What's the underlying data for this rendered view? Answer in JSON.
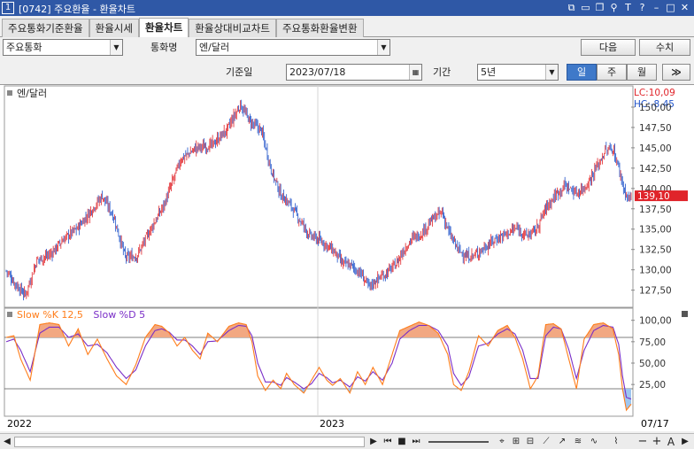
{
  "window": {
    "number": "1",
    "title": "[0742] 주요환율 - 환율차트",
    "icons": [
      "layout-icon",
      "dock-icon",
      "window-icon",
      "pin-icon",
      "font-icon",
      "help-icon",
      "minimize-icon",
      "maximize-icon",
      "close-icon"
    ]
  },
  "tabs": [
    "주요통화기준환율",
    "환율시세",
    "환율차트",
    "환율상대비교차트",
    "주요통화환율변환"
  ],
  "active_tab": 2,
  "filters": {
    "category_value": "주요통화",
    "currency_label": "통화명",
    "currency_value": "엔/달러",
    "next_label": "다음",
    "query_label": "수치",
    "base_date_label": "기준일",
    "base_date_value": "2023/07/18",
    "period_label": "기간",
    "period_value": "5년",
    "intervals": [
      "일",
      "주",
      "월"
    ],
    "active_interval": 0,
    "expand_label": "≫"
  },
  "chart_data": [
    {
      "type": "candlestick",
      "title": "엔/달러",
      "lc_label": "LC:10,09",
      "hc_label": "HC:-8,45",
      "current_value_label": "139,10",
      "ylim": [
        125.5,
        152.5
      ],
      "y_ticks": [
        "150,00",
        "147,50",
        "145,00",
        "142,50",
        "140,00",
        "137,50",
        "135,00",
        "132,50",
        "130,00",
        "127,50"
      ],
      "y_tick_values": [
        150,
        147.5,
        145,
        142.5,
        140,
        137.5,
        135,
        132.5,
        130,
        127.5
      ],
      "colors": {
        "up": "#e0242a",
        "down": "#1f52c9",
        "current_bg": "#e0242a"
      },
      "anchors_index_close": [
        [
          0,
          129.9
        ],
        [
          10,
          128.2
        ],
        [
          20,
          126.9
        ],
        [
          32,
          131.2
        ],
        [
          46,
          131.9
        ],
        [
          60,
          133.8
        ],
        [
          74,
          135.1
        ],
        [
          84,
          136.6
        ],
        [
          100,
          139.1
        ],
        [
          112,
          136.5
        ],
        [
          124,
          131.5
        ],
        [
          136,
          131.7
        ],
        [
          150,
          134.9
        ],
        [
          164,
          137.9
        ],
        [
          182,
          143.6
        ],
        [
          198,
          145.0
        ],
        [
          214,
          145.3
        ],
        [
          230,
          147.2
        ],
        [
          244,
          150.3
        ],
        [
          254,
          148.2
        ],
        [
          266,
          147.1
        ],
        [
          276,
          142.3
        ],
        [
          286,
          139.2
        ],
        [
          296,
          138.0
        ],
        [
          306,
          136.1
        ],
        [
          316,
          134.2
        ],
        [
          330,
          133.4
        ],
        [
          342,
          132.2
        ],
        [
          350,
          130.8
        ],
        [
          360,
          130.5
        ],
        [
          370,
          129.4
        ],
        [
          378,
          127.9
        ],
        [
          386,
          128.8
        ],
        [
          396,
          129.6
        ],
        [
          406,
          130.7
        ],
        [
          414,
          132.4
        ],
        [
          422,
          133.8
        ],
        [
          432,
          134.4
        ],
        [
          444,
          136.2
        ],
        [
          454,
          137.1
        ],
        [
          462,
          134.3
        ],
        [
          472,
          132.3
        ],
        [
          480,
          131.6
        ],
        [
          488,
          131.8
        ],
        [
          500,
          132.9
        ],
        [
          510,
          133.8
        ],
        [
          520,
          134.4
        ],
        [
          532,
          135.1
        ],
        [
          542,
          134.2
        ],
        [
          552,
          134.9
        ],
        [
          562,
          137.6
        ],
        [
          572,
          139.2
        ],
        [
          582,
          140.4
        ],
        [
          594,
          139.4
        ],
        [
          604,
          140.3
        ],
        [
          614,
          142.4
        ],
        [
          624,
          144.6
        ],
        [
          632,
          144.9
        ],
        [
          638,
          142.5
        ],
        [
          644,
          139.7
        ],
        [
          648,
          138.6
        ],
        [
          651,
          139.1
        ]
      ]
    },
    {
      "type": "line",
      "title": "Slow %K 12,5   Slow %D 5",
      "series": [
        {
          "name": "Slow %K 12,5",
          "color": "#ff7d1a"
        },
        {
          "name": "Slow %D 5",
          "color": "#7a2ec7"
        }
      ],
      "ylim": [
        -10,
        110
      ],
      "y_ticks": [
        "100,00",
        "75,00",
        "50,00",
        "25,00"
      ],
      "y_tick_values": [
        100,
        75,
        50,
        25
      ],
      "reference_lines": [
        80,
        20
      ],
      "fill_colors": {
        "over": "#f2a882",
        "under": "#9ec6f0"
      },
      "anchors_index_k": [
        [
          0,
          80
        ],
        [
          8,
          82
        ],
        [
          15,
          55
        ],
        [
          25,
          30
        ],
        [
          35,
          95
        ],
        [
          45,
          97
        ],
        [
          55,
          95
        ],
        [
          65,
          70
        ],
        [
          75,
          90
        ],
        [
          85,
          60
        ],
        [
          95,
          78
        ],
        [
          105,
          55
        ],
        [
          115,
          35
        ],
        [
          125,
          25
        ],
        [
          135,
          48
        ],
        [
          145,
          80
        ],
        [
          155,
          95
        ],
        [
          162,
          93
        ],
        [
          170,
          85
        ],
        [
          178,
          70
        ],
        [
          186,
          80
        ],
        [
          194,
          65
        ],
        [
          202,
          55
        ],
        [
          210,
          85
        ],
        [
          220,
          75
        ],
        [
          232,
          93
        ],
        [
          242,
          97
        ],
        [
          250,
          95
        ],
        [
          256,
          75
        ],
        [
          262,
          35
        ],
        [
          270,
          18
        ],
        [
          278,
          30
        ],
        [
          286,
          20
        ],
        [
          292,
          38
        ],
        [
          300,
          25
        ],
        [
          310,
          15
        ],
        [
          318,
          30
        ],
        [
          326,
          45
        ],
        [
          334,
          30
        ],
        [
          340,
          24
        ],
        [
          348,
          32
        ],
        [
          358,
          15
        ],
        [
          366,
          40
        ],
        [
          374,
          25
        ],
        [
          382,
          45
        ],
        [
          392,
          25
        ],
        [
          402,
          60
        ],
        [
          410,
          88
        ],
        [
          420,
          93
        ],
        [
          430,
          98
        ],
        [
          440,
          94
        ],
        [
          450,
          85
        ],
        [
          460,
          60
        ],
        [
          466,
          25
        ],
        [
          474,
          18
        ],
        [
          482,
          40
        ],
        [
          492,
          82
        ],
        [
          502,
          70
        ],
        [
          512,
          88
        ],
        [
          522,
          94
        ],
        [
          530,
          80
        ],
        [
          538,
          55
        ],
        [
          546,
          20
        ],
        [
          554,
          35
        ],
        [
          562,
          95
        ],
        [
          570,
          96
        ],
        [
          578,
          90
        ],
        [
          586,
          55
        ],
        [
          594,
          20
        ],
        [
          602,
          78
        ],
        [
          612,
          95
        ],
        [
          622,
          97
        ],
        [
          632,
          90
        ],
        [
          638,
          60
        ],
        [
          642,
          20
        ],
        [
          646,
          -5
        ],
        [
          651,
          2
        ]
      ],
      "anchors_index_d": [
        [
          0,
          75
        ],
        [
          8,
          78
        ],
        [
          15,
          65
        ],
        [
          25,
          40
        ],
        [
          35,
          85
        ],
        [
          45,
          92
        ],
        [
          55,
          92
        ],
        [
          65,
          80
        ],
        [
          75,
          84
        ],
        [
          85,
          70
        ],
        [
          95,
          72
        ],
        [
          105,
          62
        ],
        [
          115,
          45
        ],
        [
          125,
          32
        ],
        [
          135,
          42
        ],
        [
          145,
          70
        ],
        [
          155,
          88
        ],
        [
          162,
          90
        ],
        [
          170,
          86
        ],
        [
          178,
          77
        ],
        [
          186,
          77
        ],
        [
          194,
          70
        ],
        [
          202,
          60
        ],
        [
          210,
          75
        ],
        [
          220,
          76
        ],
        [
          232,
          88
        ],
        [
          242,
          94
        ],
        [
          250,
          93
        ],
        [
          256,
          82
        ],
        [
          262,
          50
        ],
        [
          270,
          28
        ],
        [
          278,
          28
        ],
        [
          286,
          24
        ],
        [
          292,
          33
        ],
        [
          300,
          28
        ],
        [
          310,
          20
        ],
        [
          318,
          26
        ],
        [
          326,
          38
        ],
        [
          334,
          33
        ],
        [
          340,
          27
        ],
        [
          348,
          30
        ],
        [
          358,
          22
        ],
        [
          366,
          34
        ],
        [
          374,
          29
        ],
        [
          382,
          40
        ],
        [
          392,
          30
        ],
        [
          402,
          50
        ],
        [
          410,
          78
        ],
        [
          420,
          88
        ],
        [
          430,
          94
        ],
        [
          440,
          94
        ],
        [
          450,
          88
        ],
        [
          460,
          70
        ],
        [
          466,
          38
        ],
        [
          474,
          24
        ],
        [
          482,
          34
        ],
        [
          492,
          70
        ],
        [
          502,
          73
        ],
        [
          512,
          84
        ],
        [
          522,
          90
        ],
        [
          530,
          84
        ],
        [
          538,
          65
        ],
        [
          546,
          32
        ],
        [
          554,
          32
        ],
        [
          562,
          82
        ],
        [
          570,
          92
        ],
        [
          578,
          90
        ],
        [
          586,
          66
        ],
        [
          594,
          32
        ],
        [
          602,
          65
        ],
        [
          612,
          88
        ],
        [
          622,
          94
        ],
        [
          632,
          92
        ],
        [
          638,
          72
        ],
        [
          642,
          35
        ],
        [
          646,
          10
        ],
        [
          651,
          8
        ]
      ]
    }
  ],
  "x_axis": {
    "labels": [
      "2022",
      "2023",
      "07/17"
    ],
    "bar_count": 652
  },
  "bottom_toolbar": {
    "icons": [
      "scroll-left-icon",
      "play-icon",
      "rewind-icon",
      "stop-icon",
      "fast-forward-icon",
      "range-slider-icon",
      "crosshair-icon",
      "grid-icon",
      "indicator-icon",
      "line-draw-icon",
      "trend-icon",
      "fibonacci-icon",
      "wave-icon",
      "zoom-out-icon",
      "zoom-in-icon",
      "text-icon",
      "scroll-right-icon"
    ],
    "zoom_out": "−",
    "zoom_in": "+",
    "text_tool": "A"
  }
}
